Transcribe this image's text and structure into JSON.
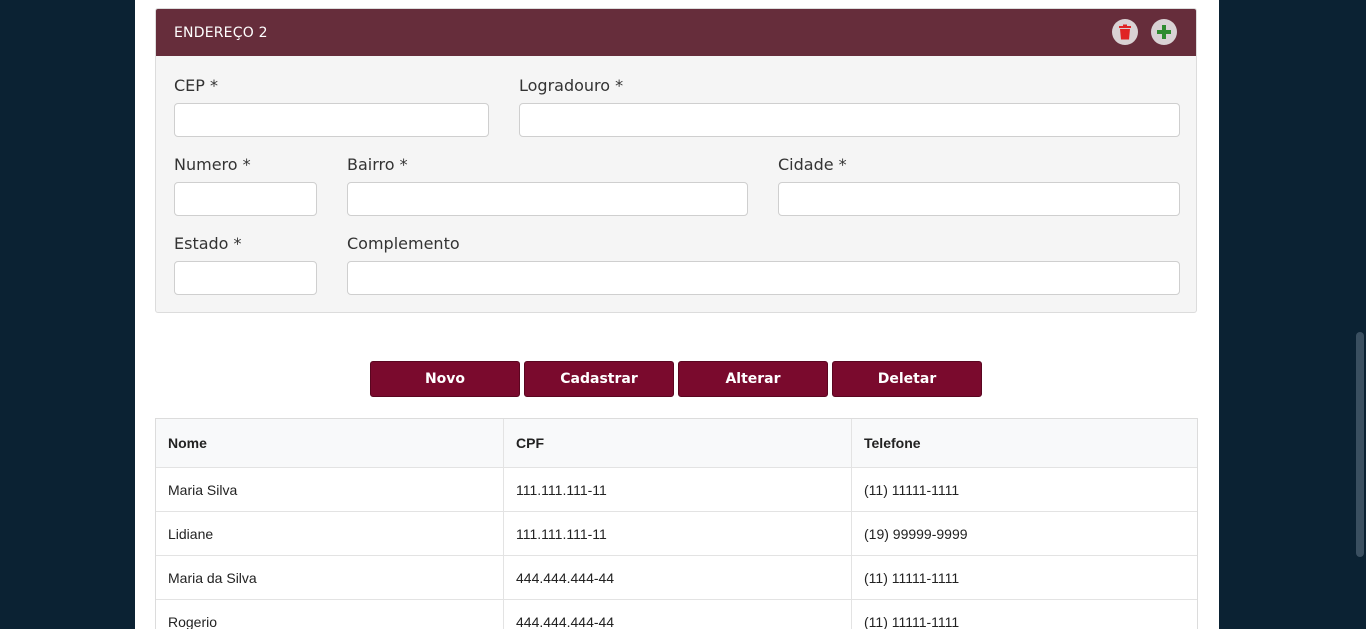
{
  "colors": {
    "header_bg": "#662d3b",
    "button_bg": "#7a0a2d",
    "page_bg": "#0b2233",
    "delete_icon": "#e02424",
    "add_icon": "#2e8b2e"
  },
  "panel": {
    "title": "ENDEREÇO 2",
    "delete_icon": "trash-icon",
    "add_icon": "plus-icon"
  },
  "form": {
    "cep_label": "CEP *",
    "logradouro_label": "Logradouro *",
    "numero_label": "Numero *",
    "bairro_label": "Bairro *",
    "cidade_label": "Cidade *",
    "estado_label": "Estado *",
    "complemento_label": "Complemento"
  },
  "actions": {
    "novo": "Novo",
    "cadastrar": "Cadastrar",
    "alterar": "Alterar",
    "deletar": "Deletar"
  },
  "table": {
    "headers": [
      "Nome",
      "CPF",
      "Telefone"
    ],
    "rows": [
      [
        "Maria Silva",
        "111.111.111-11",
        "(11) 11111-1111"
      ],
      [
        "Lidiane",
        "111.111.111-11",
        "(19) 99999-9999"
      ],
      [
        "Maria da Silva",
        "444.444.444-44",
        "(11) 11111-1111"
      ],
      [
        "Rogerio",
        "444.444.444-44",
        "(11) 11111-1111"
      ]
    ]
  }
}
